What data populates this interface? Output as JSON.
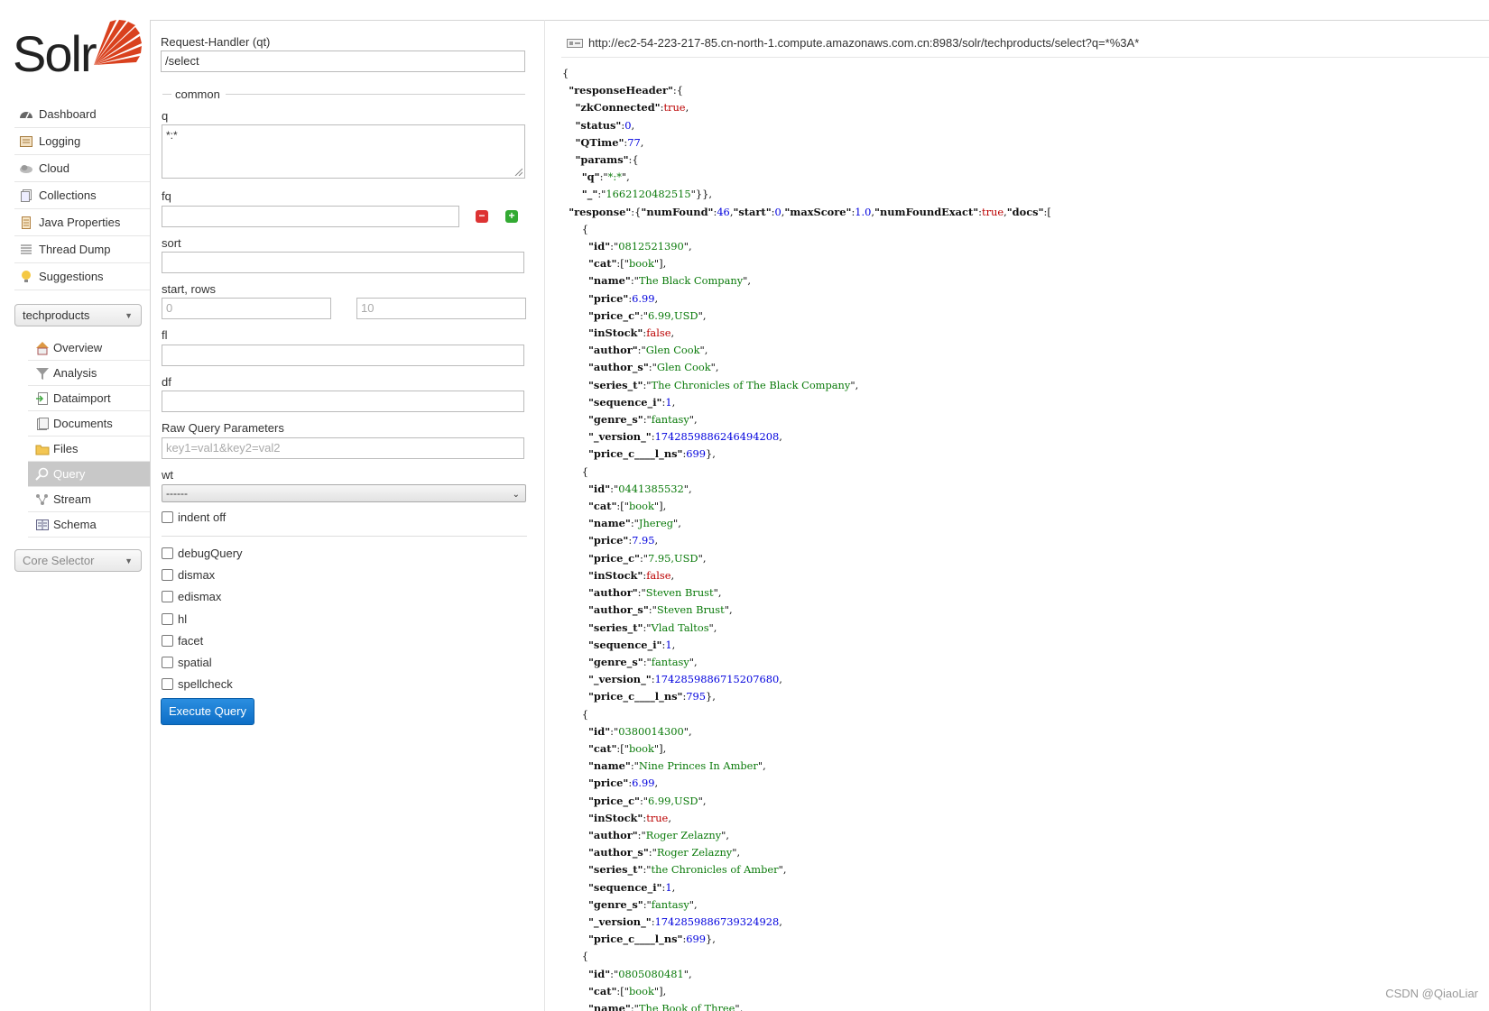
{
  "sidebar": {
    "logo_text": "Solr",
    "nav": [
      {
        "label": "Dashboard",
        "icon": "dashboard-icon"
      },
      {
        "label": "Logging",
        "icon": "logging-icon"
      },
      {
        "label": "Cloud",
        "icon": "cloud-icon"
      },
      {
        "label": "Collections",
        "icon": "collections-icon"
      },
      {
        "label": "Java Properties",
        "icon": "java-icon"
      },
      {
        "label": "Thread Dump",
        "icon": "thread-icon"
      },
      {
        "label": "Suggestions",
        "icon": "bulb-icon"
      }
    ],
    "core_selected": "techproducts",
    "core_menu": [
      {
        "label": "Overview",
        "icon": "home-icon",
        "active": false
      },
      {
        "label": "Analysis",
        "icon": "filter-icon",
        "active": false
      },
      {
        "label": "Dataimport",
        "icon": "dataimport-icon",
        "active": false
      },
      {
        "label": "Documents",
        "icon": "documents-icon",
        "active": false
      },
      {
        "label": "Files",
        "icon": "folder-icon",
        "active": false
      },
      {
        "label": "Query",
        "icon": "magnifier-icon",
        "active": true
      },
      {
        "label": "Stream",
        "icon": "stream-icon",
        "active": false
      },
      {
        "label": "Schema",
        "icon": "schema-icon",
        "active": false
      }
    ],
    "core_selector_placeholder": "Core Selector"
  },
  "form": {
    "request_handler_label": "Request-Handler (qt)",
    "request_handler_value": "/select",
    "common_legend": "common",
    "q_label": "q",
    "q_value": "*:*",
    "fq_label": "fq",
    "fq_value": "",
    "sort_label": "sort",
    "sort_value": "",
    "start_rows_label": "start, rows",
    "start_placeholder": "0",
    "rows_placeholder": "10",
    "fl_label": "fl",
    "df_label": "df",
    "raw_label": "Raw Query Parameters",
    "raw_placeholder": "key1=val1&key2=val2",
    "wt_label": "wt",
    "wt_value": "------",
    "indent_label": "indent off",
    "checkboxes": [
      "debugQuery",
      "dismax",
      "edismax",
      "hl",
      "facet",
      "spatial",
      "spellcheck"
    ],
    "execute_label": "Execute Query"
  },
  "response": {
    "url": "http://ec2-54-223-217-85.cn-north-1.compute.amazonaws.com.cn:8983/solr/techproducts/select?q=*%3A*",
    "header": {
      "zkConnected": "true",
      "status": "0",
      "QTime": "77",
      "q": "*:*",
      "underscore": "1662120482515"
    },
    "numFound": "46",
    "start": "0",
    "maxScore": "1.0",
    "numFoundExact": "true",
    "docs": [
      {
        "id": "0812521390",
        "cat": "book",
        "name": "The Black Company",
        "price": "6.99",
        "price_c": "6.99,USD",
        "inStock": "false",
        "author": "Glen Cook",
        "author_s": "Glen Cook",
        "series_t": "The Chronicles of The Black Company",
        "sequence_i": "1",
        "genre_s": "fantasy",
        "version": "1742859886246494208",
        "price_c_ns": "699"
      },
      {
        "id": "0441385532",
        "cat": "book",
        "name": "Jhereg",
        "price": "7.95",
        "price_c": "7.95,USD",
        "inStock": "false",
        "author": "Steven Brust",
        "author_s": "Steven Brust",
        "series_t": "Vlad Taltos",
        "sequence_i": "1",
        "genre_s": "fantasy",
        "version": "1742859886715207680",
        "price_c_ns": "795"
      },
      {
        "id": "0380014300",
        "cat": "book",
        "name": "Nine Princes In Amber",
        "price": "6.99",
        "price_c": "6.99,USD",
        "inStock": "true",
        "author": "Roger Zelazny",
        "author_s": "Roger Zelazny",
        "series_t": "the Chronicles of Amber",
        "sequence_i": "1",
        "genre_s": "fantasy",
        "version": "1742859886739324928",
        "price_c_ns": "699"
      },
      {
        "id": "0805080481",
        "cat": "book",
        "name": "The Book of Three"
      }
    ]
  },
  "watermark": "CSDN @QiaoLiar",
  "colors": {
    "accent": "#0d6ec6",
    "json_string": "#0a7a0a",
    "json_number": "#0000dd",
    "json_bool": "#bb0000"
  }
}
